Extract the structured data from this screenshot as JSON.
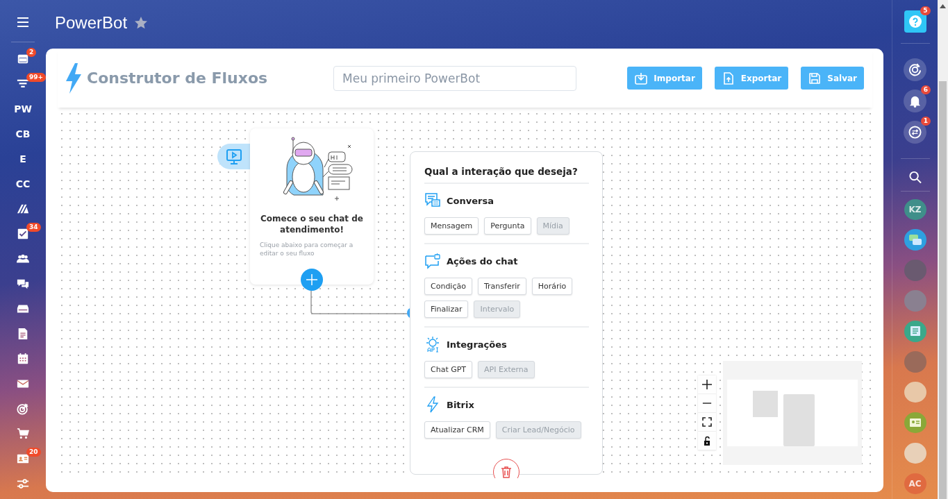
{
  "app": {
    "title": "PowerBot",
    "favorite": false
  },
  "left_nav": [
    {
      "kind": "icon",
      "badge": "2"
    },
    {
      "kind": "icon",
      "badge": "99+"
    },
    {
      "kind": "text",
      "label": "PW"
    },
    {
      "kind": "text",
      "label": "CB"
    },
    {
      "kind": "text",
      "label": "E"
    },
    {
      "kind": "text",
      "label": "CC"
    },
    {
      "kind": "icon"
    },
    {
      "kind": "icon",
      "badge": "34"
    },
    {
      "kind": "icon"
    },
    {
      "kind": "icon"
    },
    {
      "kind": "icon"
    },
    {
      "kind": "icon"
    },
    {
      "kind": "icon"
    },
    {
      "kind": "icon"
    },
    {
      "kind": "icon"
    },
    {
      "kind": "icon"
    },
    {
      "kind": "icon",
      "badge": "20"
    },
    {
      "kind": "icon"
    }
  ],
  "right_nav": {
    "help": {
      "badge": "5"
    },
    "tools": [
      {
        "kind": "icon"
      },
      {
        "kind": "icon",
        "badge": "6"
      },
      {
        "kind": "icon",
        "badge": "1"
      }
    ],
    "contacts": [
      {
        "kind": "initials",
        "label": "KZ",
        "color": "#3f8f8a"
      },
      {
        "kind": "icon",
        "color": "#2ea0e0"
      },
      {
        "kind": "photo",
        "color": "#6a5a70"
      },
      {
        "kind": "photo",
        "color": "#8a8090"
      },
      {
        "kind": "icon",
        "color": "#3aa88a"
      },
      {
        "kind": "photo",
        "color": "#9a6a5a"
      },
      {
        "kind": "photo",
        "color": "#e8c8a8"
      },
      {
        "kind": "icon",
        "color": "#8aa838"
      },
      {
        "kind": "photo",
        "color": "#e8d0b8"
      },
      {
        "kind": "initials",
        "label": "AC",
        "color": "#e06a40"
      }
    ]
  },
  "builder": {
    "title": "Construtor de Fluxos",
    "flow_name": "Meu primeiro PowerBot",
    "buttons": [
      {
        "kind": "import",
        "label": "Importar"
      },
      {
        "kind": "export",
        "label": "Exportar"
      },
      {
        "kind": "save",
        "label": "Salvar"
      }
    ]
  },
  "start_node": {
    "title": "Comece o seu chat de atendimento!",
    "hint": "Clique abaixo para começar a editar o seu fluxo"
  },
  "menu": {
    "title": "Qual a interação que deseja?",
    "sections": [
      {
        "kind": "chat",
        "title": "Conversa",
        "options": [
          {
            "label": "Mensagem",
            "disabled": false
          },
          {
            "label": "Pergunta",
            "disabled": false
          },
          {
            "label": "Mídia",
            "disabled": true
          }
        ]
      },
      {
        "kind": "bot",
        "title": "Ações do chat",
        "options": [
          {
            "label": "Condição",
            "disabled": false
          },
          {
            "label": "Transferir",
            "disabled": false
          },
          {
            "label": "Horário",
            "disabled": false
          },
          {
            "label": "Finalizar",
            "disabled": false
          },
          {
            "label": "Intervalo",
            "disabled": true
          }
        ]
      },
      {
        "kind": "api",
        "title": "Integrações",
        "options": [
          {
            "label": "Chat GPT",
            "disabled": false
          },
          {
            "label": "API Externa",
            "disabled": true
          }
        ]
      },
      {
        "kind": "bolt",
        "title": "Bitrix",
        "options": [
          {
            "label": "Atualizar CRM",
            "disabled": false
          },
          {
            "label": "Criar Lead/Negócio",
            "disabled": true
          }
        ]
      }
    ]
  }
}
